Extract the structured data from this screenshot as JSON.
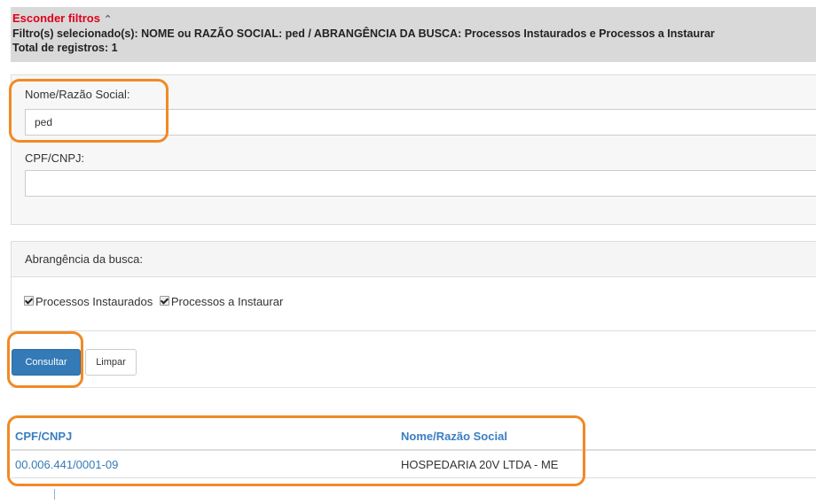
{
  "filters": {
    "toggle_label": "Esconder filtros",
    "toggle_icon": "double-chevron-up-icon",
    "selected_summary": "Filtro(s) selecionado(s): NOME ou RAZÃO SOCIAL: ped / ABRANGÊNCIA DA BUSCA: Processos Instaurados e Processos a Instaurar",
    "total_records": "Total de registros: 1"
  },
  "form": {
    "name_label": "Nome/Razão Social:",
    "name_value": "ped",
    "cpf_label": "CPF/CNPJ:",
    "cpf_value": ""
  },
  "scope": {
    "heading": "Abrangência da busca:",
    "options": [
      {
        "label": "Processos Instaurados",
        "checked": true
      },
      {
        "label": "Processos a Instaurar",
        "checked": true
      }
    ]
  },
  "actions": {
    "search_label": "Consultar",
    "clear_label": "Limpar"
  },
  "results": {
    "columns": [
      "CPF/CNPJ",
      "Nome/Razão Social"
    ],
    "rows": [
      [
        "00.006.441/0001-09",
        "HOSPEDARIA 20V LTDA - ME"
      ]
    ]
  },
  "colors": {
    "highlight": "#f08a24",
    "toggle_red": "#e0001b",
    "primary_blue": "#337ab7"
  }
}
